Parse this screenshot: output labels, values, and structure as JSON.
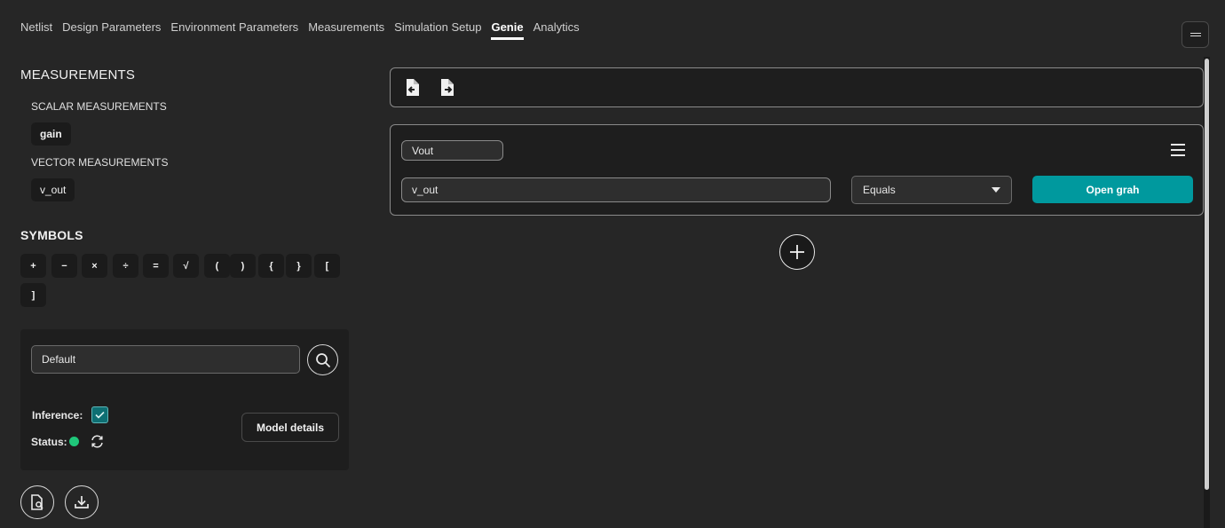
{
  "tabs": [
    {
      "label": "Netlist"
    },
    {
      "label": "Design Parameters"
    },
    {
      "label": "Environment Parameters"
    },
    {
      "label": "Measurements"
    },
    {
      "label": "Simulation Setup"
    },
    {
      "label": "Genie"
    },
    {
      "label": "Analytics"
    }
  ],
  "active_tab": "Genie",
  "sidebar": {
    "measurements_title": "MEASUREMENTS",
    "scalar_title": "SCALAR MEASUREMENTS",
    "scalar_items": [
      "gain"
    ],
    "vector_title": "VECTOR MEASUREMENTS",
    "vector_items": [
      "v_out"
    ],
    "symbols_title": "SYMBOLS",
    "symbols": [
      "+",
      "−",
      "×",
      "÷",
      "=",
      "√",
      "(",
      ")",
      "{",
      "}",
      "[",
      "]"
    ]
  },
  "model": {
    "select_value": "Default",
    "inference_label": "Inference:",
    "inference_checked": true,
    "status_label": "Status:",
    "status_color": "#1fc77a",
    "details_button": "Model details"
  },
  "card": {
    "name_value": "Vout",
    "expression_value": "v_out",
    "operator_value": "Equals",
    "open_button": "Open grah"
  },
  "colors": {
    "accent": "#00999e",
    "background": "#262626",
    "panel": "#1e1e1e"
  },
  "icons": {
    "import": "file-import-icon",
    "export": "file-export-icon",
    "menu": "hamburger-icon",
    "add": "plus-icon",
    "search": "search-icon",
    "refresh": "refresh-icon",
    "file_search": "file-search-icon",
    "download": "download-icon"
  }
}
